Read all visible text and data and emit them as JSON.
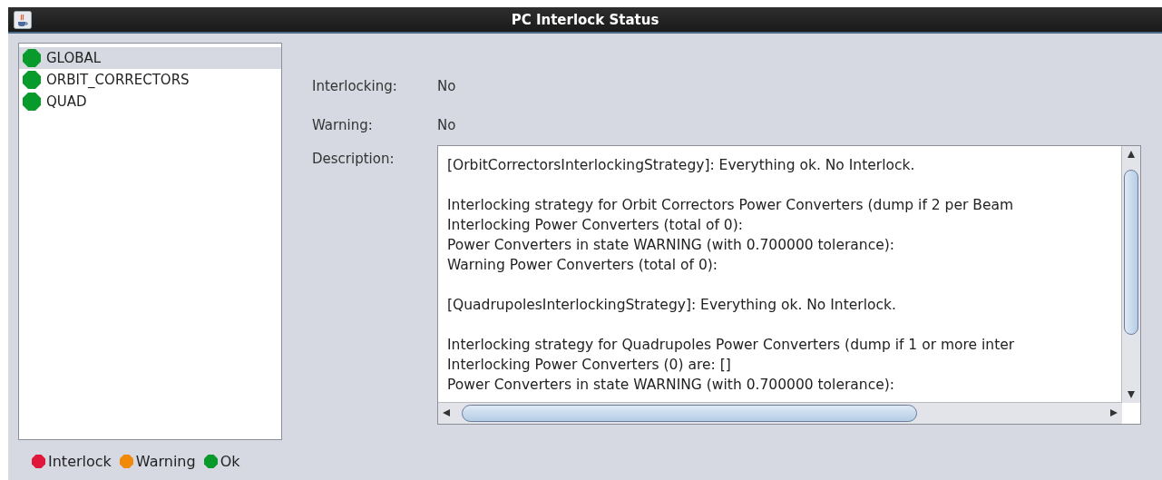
{
  "window": {
    "title": "PC Interlock Status"
  },
  "tree": {
    "items": [
      {
        "label": "GLOBAL",
        "selected": true,
        "color": "#089a2a"
      },
      {
        "label": "ORBIT_CORRECTORS",
        "selected": false,
        "color": "#089a2a"
      },
      {
        "label": "QUAD",
        "selected": false,
        "color": "#089a2a"
      }
    ]
  },
  "legend": [
    {
      "label": "Interlock",
      "color": "#e0163a"
    },
    {
      "label": "Warning",
      "color": "#f08a08"
    },
    {
      "label": "Ok",
      "color": "#089a2a"
    }
  ],
  "fields": [
    {
      "label": "Interlocking:",
      "value": "No"
    },
    {
      "label": "Warning:",
      "value": "No"
    }
  ],
  "description": {
    "label": "Description:",
    "paragraphs": [
      [
        "[OrbitCorrectorsInterlockingStrategy]: Everything ok. No Interlock."
      ],
      [
        "Interlocking strategy for Orbit Correctors Power Converters (dump if 2 per Beam",
        "Interlocking Power Converters (total of 0):",
        "Power Converters in state WARNING (with 0.700000 tolerance):",
        "Warning Power Converters (total of 0):"
      ],
      [
        "[QuadrupolesInterlockingStrategy]: Everything ok. No Interlock."
      ],
      [
        "Interlocking strategy for Quadrupoles Power Converters (dump if 1 or more inter",
        "Interlocking Power Converters (0) are: []",
        "Power Converters in state WARNING (with 0.700000 tolerance):"
      ]
    ]
  }
}
